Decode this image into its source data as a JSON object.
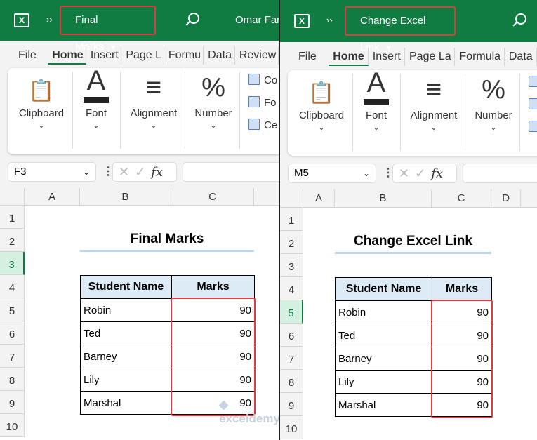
{
  "panes": [
    {
      "file_name": "Final Marks",
      "user": "Omar Faru",
      "tabs": [
        "File",
        "Home",
        "Insert",
        "Page L",
        "Formu",
        "Data",
        "Review"
      ],
      "ribbon": {
        "groups": [
          "Clipboard",
          "Font",
          "Alignment",
          "Number"
        ],
        "mini": [
          "Co",
          "Fo",
          "Ce"
        ]
      },
      "name_box": "F3",
      "columns": [
        "A",
        "B",
        "C"
      ],
      "rows": [
        "1",
        "2",
        "3",
        "4",
        "5",
        "6",
        "7",
        "8",
        "9",
        "10"
      ],
      "selected_row": "3",
      "sheet_title": "Final Marks",
      "table": {
        "headers": [
          "Student Name",
          "Marks"
        ],
        "rows": [
          [
            "Robin",
            "90"
          ],
          [
            "Ted",
            "90"
          ],
          [
            "Barney",
            "90"
          ],
          [
            "Lily",
            "90"
          ],
          [
            "Marshal",
            "90"
          ]
        ]
      }
    },
    {
      "file_name": "Change Excel Link",
      "user": "",
      "tabs": [
        "File",
        "Home",
        "Insert",
        "Page La",
        "Formula",
        "Data"
      ],
      "ribbon": {
        "groups": [
          "Clipboard",
          "Font",
          "Alignment",
          "Number"
        ],
        "mini": [
          "",
          "",
          ""
        ]
      },
      "name_box": "M5",
      "columns": [
        "A",
        "B",
        "C",
        "D"
      ],
      "rows": [
        "1",
        "2",
        "3",
        "4",
        "5",
        "6",
        "7",
        "8",
        "9",
        "10"
      ],
      "selected_row": "5",
      "sheet_title": "Change Excel Link",
      "table": {
        "headers": [
          "Student Name",
          "Marks"
        ],
        "rows": [
          [
            "Robin",
            "90"
          ],
          [
            "Ted",
            "90"
          ],
          [
            "Barney",
            "90"
          ],
          [
            "Lily",
            "90"
          ],
          [
            "Marshal",
            "90"
          ]
        ]
      }
    }
  ],
  "app_icon": "excel-icon",
  "expand_icon_text": "››",
  "fx_label": "fx",
  "watermark": "exceldemy",
  "colors": {
    "brand": "#107c41",
    "highlight": "#e0393e",
    "table_header": "#ddebf7"
  }
}
